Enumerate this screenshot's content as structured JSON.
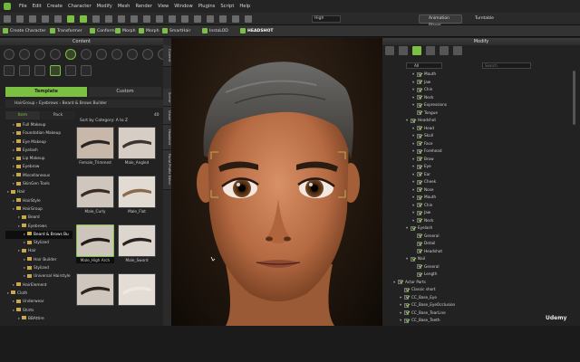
{
  "menubar": {
    "items": [
      "File",
      "Edit",
      "Create",
      "Character",
      "Modify",
      "Mesh",
      "Render",
      "View",
      "Window",
      "Plugins",
      "Script",
      "Help"
    ]
  },
  "toolbar": {
    "quality": "High",
    "animation_player": "Animation Player",
    "turntable": "Turntable"
  },
  "modebar": {
    "create_character": "Create Character",
    "transformer": "Transformer",
    "conform": "Conform",
    "morph": "Morph",
    "morph_short": "Morph",
    "smart_hair": "SmartHair",
    "instalod": "InstaLOD",
    "headshot": "HEADSHOT"
  },
  "content": {
    "title": "Content",
    "tab_template": "Template",
    "tab_custom": "Custom",
    "path": [
      "HairGroup",
      "Eyebrows",
      "Beard & Brows Builder"
    ],
    "sub_tabs": [
      "Item",
      "Pack"
    ],
    "sort": "Sort by Category: A to Z",
    "zoom": "40",
    "side_tabs": [
      "Content",
      "Scene",
      "Visual",
      "Headshot",
      "Facial Profile Editor"
    ],
    "tree": [
      {
        "label": "Full Makeup",
        "indent": 1
      },
      {
        "label": "Foundation Makeup",
        "indent": 1
      },
      {
        "label": "Eye Makeup",
        "indent": 1
      },
      {
        "label": "Eyelash",
        "indent": 1
      },
      {
        "label": "Lip Makeup",
        "indent": 1
      },
      {
        "label": "Eyebrow",
        "indent": 1
      },
      {
        "label": "Miscellaneous",
        "indent": 1
      },
      {
        "label": "SkinGen Tools",
        "indent": 1
      },
      {
        "label": "Hair",
        "indent": 0
      },
      {
        "label": "HairStyle",
        "indent": 1
      },
      {
        "label": "HairGroup",
        "indent": 1
      },
      {
        "label": "Beard",
        "indent": 2
      },
      {
        "label": "Eyebrows",
        "indent": 2
      },
      {
        "label": "Beard & Brows Bu",
        "indent": 3,
        "selected": true
      },
      {
        "label": "Stylized",
        "indent": 3
      },
      {
        "label": "Hair",
        "indent": 2
      },
      {
        "label": "Hair Builder",
        "indent": 3
      },
      {
        "label": "Stylized",
        "indent": 3
      },
      {
        "label": "Universal Hairstyle",
        "indent": 3
      },
      {
        "label": "HairElement",
        "indent": 1
      },
      {
        "label": "Cloth",
        "indent": 0
      },
      {
        "label": "Underwear",
        "indent": 1
      },
      {
        "label": "Shirts",
        "indent": 1
      },
      {
        "label": "BBAttire",
        "indent": 2
      }
    ],
    "thumbs": [
      {
        "label": "Female_Trimmed",
        "color": "#c7b8a9",
        "brow": "#2a2520"
      },
      {
        "label": "Male_Angled",
        "color": "#d6cdc4",
        "brow": "#3a3530"
      },
      {
        "label": "Male_Curly",
        "color": "#cfc6bd",
        "brow": "#3b2c22"
      },
      {
        "label": "Male_Flat",
        "color": "#e2dbd3",
        "brow": "#8a6a4a"
      },
      {
        "label": "Male_High Arch",
        "color": "#cdc4bb",
        "brow": "#1e1a17",
        "selected": true
      },
      {
        "label": "Male_Sword",
        "color": "#ddd6cf",
        "brow": "#262220"
      },
      {
        "label": "",
        "color": "#cfc6bd",
        "brow": "#2a2320"
      },
      {
        "label": "",
        "color": "#e4ddd5",
        "brow": "#efe8de"
      }
    ]
  },
  "modify": {
    "title": "Modify",
    "filter": "All",
    "search_placeholder": "Search",
    "tree": [
      {
        "label": "Mouth",
        "indent": 3,
        "arrow": true
      },
      {
        "label": "Jaw",
        "indent": 3,
        "arrow": true
      },
      {
        "label": "Chin",
        "indent": 3,
        "arrow": true
      },
      {
        "label": "Neck",
        "indent": 3,
        "arrow": true
      },
      {
        "label": "Expressions",
        "indent": 3,
        "arrow": true
      },
      {
        "label": "Tongue",
        "indent": 3,
        "arrow": false
      },
      {
        "label": "Headshot",
        "indent": 2,
        "arrow": true
      },
      {
        "label": "Head",
        "indent": 3,
        "arrow": true
      },
      {
        "label": "Skull",
        "indent": 3,
        "arrow": true
      },
      {
        "label": "Face",
        "indent": 3,
        "arrow": true
      },
      {
        "label": "Forehead",
        "indent": 3,
        "arrow": true
      },
      {
        "label": "Brow",
        "indent": 3,
        "arrow": true
      },
      {
        "label": "Eye",
        "indent": 3,
        "arrow": true
      },
      {
        "label": "Ear",
        "indent": 3,
        "arrow": true
      },
      {
        "label": "Cheek",
        "indent": 3,
        "arrow": true
      },
      {
        "label": "Nose",
        "indent": 3,
        "arrow": true
      },
      {
        "label": "Mouth",
        "indent": 3,
        "arrow": true
      },
      {
        "label": "Chin",
        "indent": 3,
        "arrow": true
      },
      {
        "label": "Jaw",
        "indent": 3,
        "arrow": true
      },
      {
        "label": "Neck",
        "indent": 3,
        "arrow": true
      },
      {
        "label": "Eyelash",
        "indent": 2,
        "arrow": true
      },
      {
        "label": "General",
        "indent": 3,
        "arrow": false
      },
      {
        "label": "Detail",
        "indent": 3,
        "arrow": false
      },
      {
        "label": "Headshot",
        "indent": 3,
        "arrow": false
      },
      {
        "label": "Nail",
        "indent": 2,
        "arrow": true
      },
      {
        "label": "General",
        "indent": 3,
        "arrow": false
      },
      {
        "label": "Length",
        "indent": 3,
        "arrow": false
      },
      {
        "label": "Actor Parts",
        "indent": 0,
        "arrow": true,
        "eye": false
      },
      {
        "label": "Classic short",
        "indent": 1,
        "arrow": false
      },
      {
        "label": "CC_Base_Eye",
        "indent": 1,
        "arrow": true
      },
      {
        "label": "CC_Base_EyeOcclusion",
        "indent": 1,
        "arrow": true
      },
      {
        "label": "CC_Base_TearLine",
        "indent": 1,
        "arrow": true
      },
      {
        "label": "CC_Base_Teeth",
        "indent": 1,
        "arrow": true
      }
    ]
  },
  "watermark": "Udemy"
}
